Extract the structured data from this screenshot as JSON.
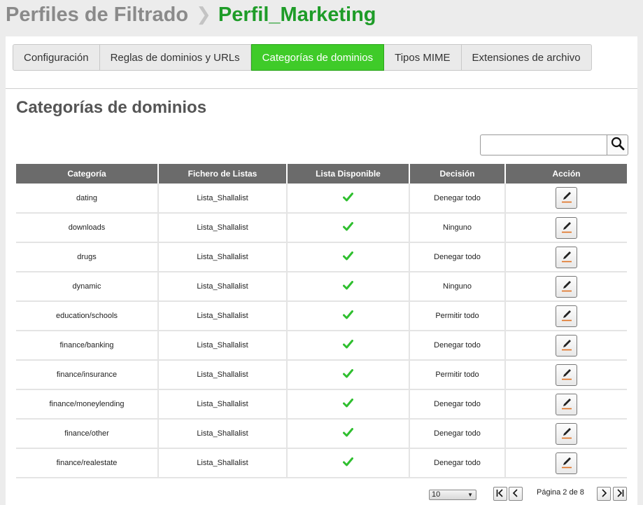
{
  "header": {
    "parent": "Perfiles de Filtrado",
    "separator": "❯",
    "current": "Perfil_Marketing"
  },
  "tabs": [
    {
      "label": "Configuración",
      "active": false
    },
    {
      "label": "Reglas de dominios y URLs",
      "active": false
    },
    {
      "label": "Categorías de dominios",
      "active": true
    },
    {
      "label": "Tipos MIME",
      "active": false
    },
    {
      "label": "Extensiones de archivo",
      "active": false
    }
  ],
  "section": {
    "title": "Categorías de dominios"
  },
  "search": {
    "value": "",
    "placeholder": "",
    "icon": "search-icon"
  },
  "table": {
    "columns": [
      "Categoría",
      "Fichero de Listas",
      "Lista Disponible",
      "Decisión",
      "Acción"
    ],
    "rows": [
      {
        "category": "dating",
        "list_file": "Lista_Shallalist",
        "available": true,
        "decision": "Denegar todo"
      },
      {
        "category": "downloads",
        "list_file": "Lista_Shallalist",
        "available": true,
        "decision": "Ninguno"
      },
      {
        "category": "drugs",
        "list_file": "Lista_Shallalist",
        "available": true,
        "decision": "Denegar todo"
      },
      {
        "category": "dynamic",
        "list_file": "Lista_Shallalist",
        "available": true,
        "decision": "Ninguno"
      },
      {
        "category": "education/schools",
        "list_file": "Lista_Shallalist",
        "available": true,
        "decision": "Permitir todo"
      },
      {
        "category": "finance/banking",
        "list_file": "Lista_Shallalist",
        "available": true,
        "decision": "Denegar todo"
      },
      {
        "category": "finance/insurance",
        "list_file": "Lista_Shallalist",
        "available": true,
        "decision": "Permitir todo"
      },
      {
        "category": "finance/moneylending",
        "list_file": "Lista_Shallalist",
        "available": true,
        "decision": "Denegar todo"
      },
      {
        "category": "finance/other",
        "list_file": "Lista_Shallalist",
        "available": true,
        "decision": "Denegar todo"
      },
      {
        "category": "finance/realestate",
        "list_file": "Lista_Shallalist",
        "available": true,
        "decision": "Denegar todo"
      }
    ]
  },
  "pagination": {
    "page_size": "10",
    "page_info": "Página 2 de 8",
    "icons": [
      "first-page-icon",
      "previous-page-icon",
      "next-page-icon",
      "last-page-icon"
    ]
  },
  "colors": {
    "accent_green": "#3fcb29",
    "title_green": "#1e9c28",
    "check_green": "#2fbf2f",
    "header_gray": "#6b6b6b",
    "pencil_underline": "#e07020"
  }
}
